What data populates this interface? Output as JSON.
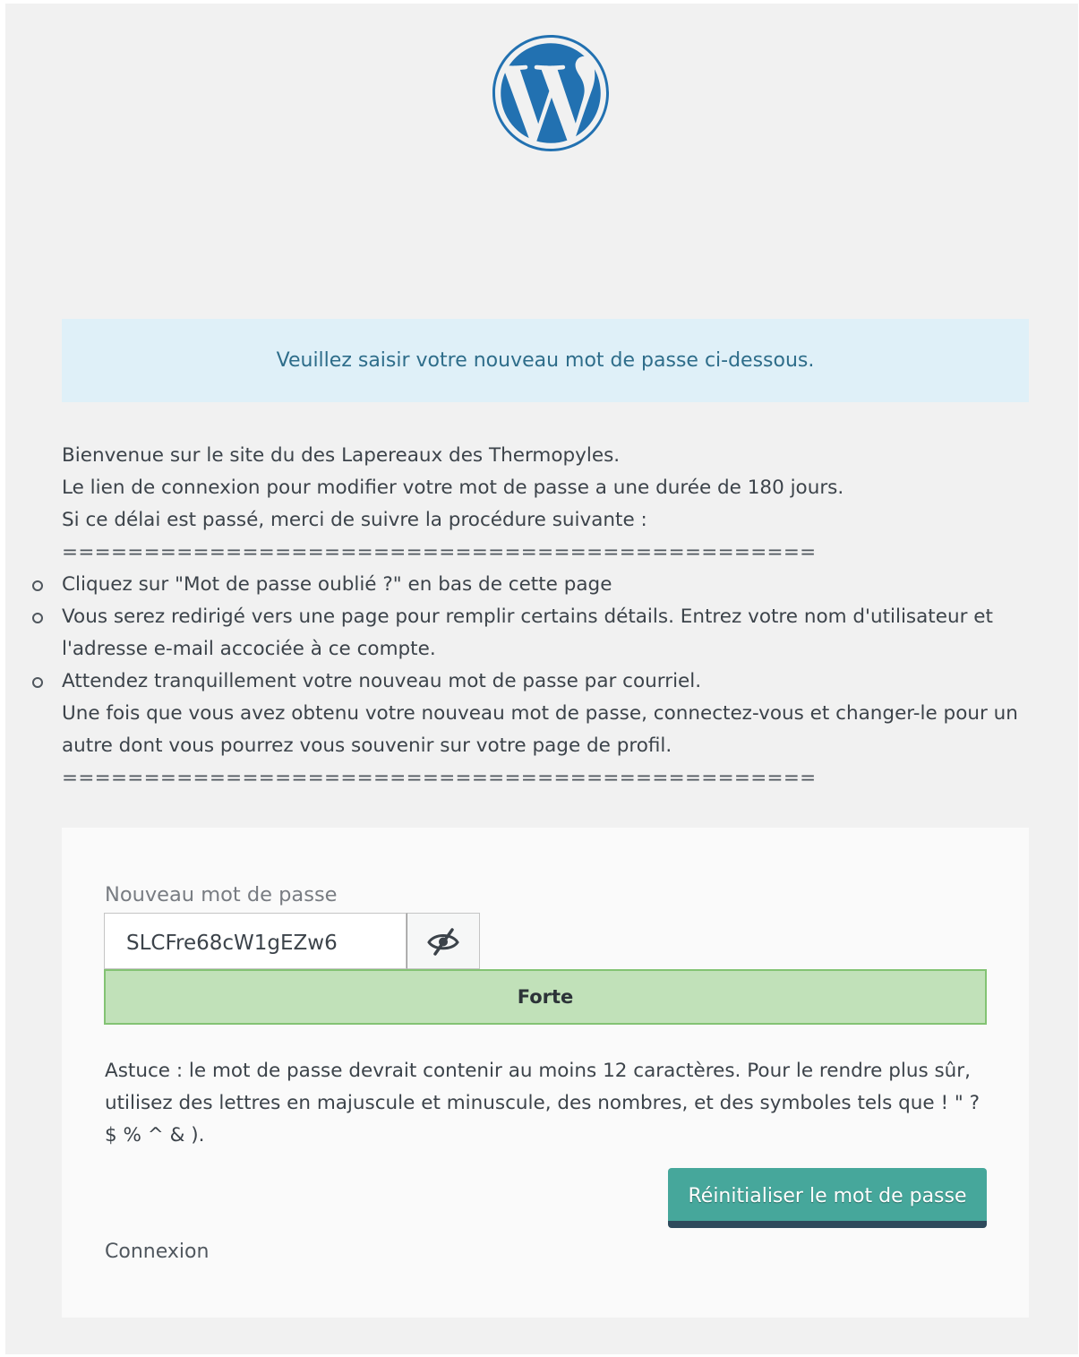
{
  "logo": {
    "icon": "wordpress-logo-icon",
    "color": "#2271b1"
  },
  "message": "Veuillez saisir votre nouveau mot de passe ci-dessous.",
  "info": {
    "lines": [
      "Bienvenue sur le site du des Lapereaux des Thermopyles.",
      "Le lien de connexion pour modifier votre mot de passe a une durée de 180 jours.",
      "Si ce délai est passé, merci de suivre la procédure suivante :"
    ],
    "separator": "===================================================",
    "steps": [
      {
        "text": "Cliquez sur \"Mot de passe oublié ?\" en bas de cette page"
      },
      {
        "text": "Vous serez redirigé vers une page pour remplir certains détails. Entrez votre nom d'utilisateur et l'adresse e-mail accociée à ce compte."
      },
      {
        "text": "Attendez tranquillement votre nouveau mot de passe par courriel.",
        "extra": "Une fois que vous avez obtenu votre nouveau mot de passe, connectez-vous et changer-le pour un autre dont vous pourrez vous souvenir sur votre page de profil."
      }
    ],
    "separator_end": "==================================================="
  },
  "form": {
    "label": "Nouveau mot de passe",
    "password_value": "SLCFre68cW1gEZw6",
    "toggle_icon": "hidden-eye-icon",
    "strength": "Forte",
    "strength_color": "#c1e1b9",
    "hint": "Astuce : le mot de passe devrait contenir au moins 12 caractères. Pour le rendre plus sûr, utilisez des lettres en majuscule et minuscule, des nombres, et des symboles tels que ! \" ? $ % ^ & ).",
    "submit_label": "Réinitialiser le mot de passe",
    "submit_color": "#46a79b",
    "login_link": "Connexion"
  }
}
